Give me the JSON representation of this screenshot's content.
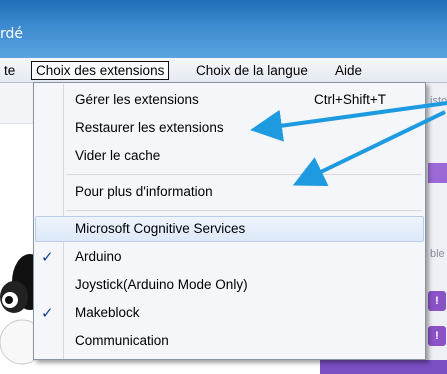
{
  "window": {
    "title_fragment": "rdé"
  },
  "menubar": {
    "items": [
      {
        "label": "te"
      },
      {
        "label": "Choix des extensions"
      },
      {
        "label": "Choix de la langue"
      },
      {
        "label": "Aide"
      }
    ]
  },
  "side_panel": {
    "text_top": "isto",
    "text_mid": "ble"
  },
  "dropdown": {
    "items": [
      {
        "label": "Gérer les extensions",
        "shortcut": "Ctrl+Shift+T"
      },
      {
        "label": "Restaurer les extensions"
      },
      {
        "label": "Vider le cache"
      },
      {
        "label": "Pour plus d'information"
      },
      {
        "label": "Microsoft Cognitive Services"
      },
      {
        "label": "Arduino",
        "checked": true
      },
      {
        "label": "Joystick(Arduino Mode Only)"
      },
      {
        "label": "Makeblock",
        "checked": true
      },
      {
        "label": "Communication"
      }
    ],
    "check_glyph": "✓"
  },
  "colors": {
    "titlebar": "#3d8bd0",
    "menu_highlight": "#dde9f8",
    "check": "#1b3f9a",
    "annotation_arrow": "#1e9be0",
    "block_purple": "#8b52c8"
  }
}
